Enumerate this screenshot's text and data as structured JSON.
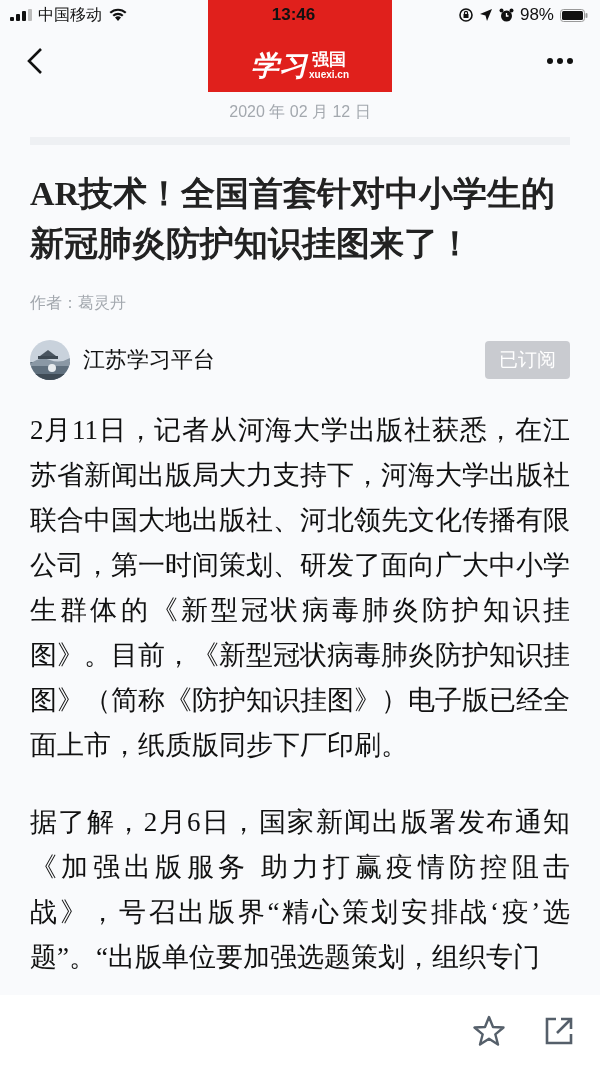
{
  "status_bar": {
    "carrier": "中国移动",
    "time": "13:46",
    "battery": "98%"
  },
  "logo": {
    "script": "学习",
    "name": "强国",
    "domain": "xuexi.cn"
  },
  "date": "2020 年 02 月 12 日",
  "title": "AR技术！全国首套针对中小学生的新冠肺炎防护知识挂图来了！",
  "author": "作者：葛灵丹",
  "channel": {
    "name": "江苏学习平台",
    "subscribe_label": "已订阅",
    "subscribed": true
  },
  "paragraphs": [
    "2月11日，记者从河海大学出版社获悉，在江苏省新闻出版局大力支持下，河海大学出版社联合中国大地出版社、河北领先文化传播有限公司，第一时间策划、研发了面向广大中小学生群体的《新型冠状病毒肺炎防护知识挂图》。目前，《新型冠状病毒肺炎防护知识挂图》（简称《防护知识挂图》）电子版已经全面上市，纸质版同步下厂印刷。",
    "据了解，2月6日，国家新闻出版署发布通知《加强出版服务 助力打赢疫情防控阻击战》，号召出版界“精心策划安排战‘疫’选题”。“出版单位要加强选题策划，组织专门"
  ]
}
